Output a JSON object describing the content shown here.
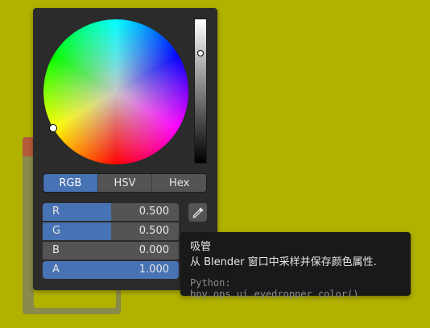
{
  "tabs": [
    {
      "label": "RGB",
      "active": true
    },
    {
      "label": "HSV",
      "active": false
    },
    {
      "label": "Hex",
      "active": false
    }
  ],
  "fields": [
    {
      "label": "R",
      "value": "0.500",
      "fill": 0.5
    },
    {
      "label": "G",
      "value": "0.500",
      "fill": 0.5
    },
    {
      "label": "B",
      "value": "0.000",
      "fill": 0.0
    },
    {
      "label": "A",
      "value": "1.000",
      "fill": 1.0
    }
  ],
  "value_slider_level": 0.76,
  "tooltip": {
    "title": "吸管",
    "description": "从 Blender 窗口中采样并保存颜色属性.",
    "python": "Python: bpy.ops.ui.eyedropper_color()"
  },
  "icons": {
    "eyedropper": "eyedropper-icon"
  },
  "colors": {
    "background": "#b1b100",
    "panel": "#2b2b2b",
    "accent": "#4772b3",
    "field": "#545454",
    "tooltip": "#191919"
  }
}
